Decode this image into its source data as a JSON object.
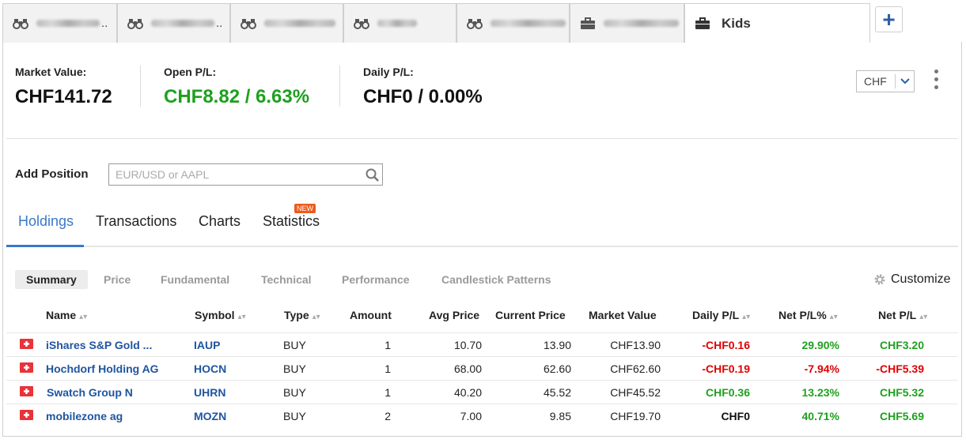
{
  "tabs": [
    {
      "label": "",
      "icon": "binoculars-icon",
      "blurred": true
    },
    {
      "label": "",
      "icon": "binoculars-icon",
      "blurred": true
    },
    {
      "label": "",
      "icon": "binoculars-icon",
      "blurred": true
    },
    {
      "label": "",
      "icon": "binoculars-icon",
      "blurred": true
    },
    {
      "label": "",
      "icon": "binoculars-icon",
      "blurred": true
    },
    {
      "label": "",
      "icon": "briefcase-icon",
      "blurred": true
    },
    {
      "label": "Kids",
      "icon": "briefcase-icon",
      "active": true
    }
  ],
  "add_tab": "+",
  "summary": {
    "market_value_label": "Market Value:",
    "market_value": "CHF141.72",
    "open_pl_label": "Open P/L:",
    "open_pl": "CHF8.82 / 6.63%",
    "daily_pl_label": "Daily P/L:",
    "daily_pl": "CHF0 / 0.00%"
  },
  "currency": {
    "selected": "CHF"
  },
  "add_position": {
    "label": "Add Position",
    "placeholder": "EUR/USD or AAPL"
  },
  "main_tabs": [
    "Holdings",
    "Transactions",
    "Charts",
    "Statistics"
  ],
  "new_badge": "NEW",
  "sub_tabs": [
    "Summary",
    "Price",
    "Fundamental",
    "Technical",
    "Performance",
    "Candlestick Patterns"
  ],
  "customize": "Customize",
  "columns": [
    "Name",
    "Symbol",
    "Type",
    "Amount",
    "Avg Price",
    "Current Price",
    "Market Value",
    "Daily P/L",
    "Net P/L%",
    "Net P/L"
  ],
  "rows": [
    {
      "name": "iShares S&P Gold ...",
      "symbol": "IAUP",
      "type": "BUY",
      "amount": "1",
      "avg_price": "10.70",
      "current_price": "13.90",
      "market_value": "CHF13.90",
      "daily_pl": "-CHF0.16",
      "net_pl_pct": "29.90%",
      "net_pl": "CHF3.20"
    },
    {
      "name": "Hochdorf Holding AG",
      "symbol": "HOCN",
      "type": "BUY",
      "amount": "1",
      "avg_price": "68.00",
      "current_price": "62.60",
      "market_value": "CHF62.60",
      "daily_pl": "-CHF0.19",
      "net_pl_pct": "-7.94%",
      "net_pl": "-CHF5.39"
    },
    {
      "name": "Swatch Group N",
      "symbol": "UHRN",
      "type": "BUY",
      "amount": "1",
      "avg_price": "40.20",
      "current_price": "45.52",
      "market_value": "CHF45.52",
      "daily_pl": "CHF0.36",
      "net_pl_pct": "13.23%",
      "net_pl": "CHF5.32"
    },
    {
      "name": "mobilezone ag",
      "symbol": "MOZN",
      "type": "BUY",
      "amount": "2",
      "avg_price": "7.00",
      "current_price": "9.85",
      "market_value": "CHF19.70",
      "daily_pl": "CHF0",
      "net_pl_pct": "40.71%",
      "net_pl": "CHF5.69"
    }
  ],
  "colors": {
    "positive": "#1ea01e",
    "negative": "#e00000",
    "neutral": "#111111",
    "link": "#1f55a0",
    "accent": "#3a78c9"
  }
}
